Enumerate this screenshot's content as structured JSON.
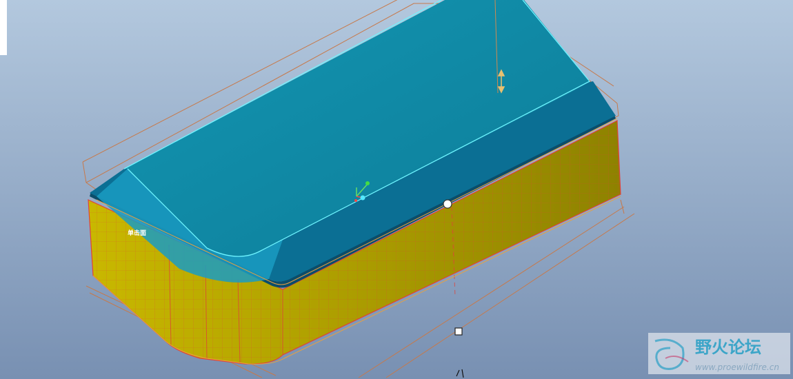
{
  "viewport": {
    "background_top": "#b0c6dc",
    "background_bottom": "#7a93b4"
  },
  "model": {
    "top_surface_color": "#0f84a0",
    "side_band_color": "#0b6f94",
    "body_wall_color": "#b8aa00",
    "mesh_line_color": "#e0423a",
    "edge_highlight_color": "#6ff4ff",
    "bounding_box_color": "#c76a3a",
    "face_annotation": "单击面"
  },
  "watermark": {
    "site_name": "野火论坛",
    "site_url": "www.proewildfire.cn",
    "accent_color": "#3ca5c8"
  },
  "icons": [
    "csys-triad-icon",
    "drag-handle-icon",
    "selection-square-icon",
    "dimension-arrow-icon"
  ]
}
